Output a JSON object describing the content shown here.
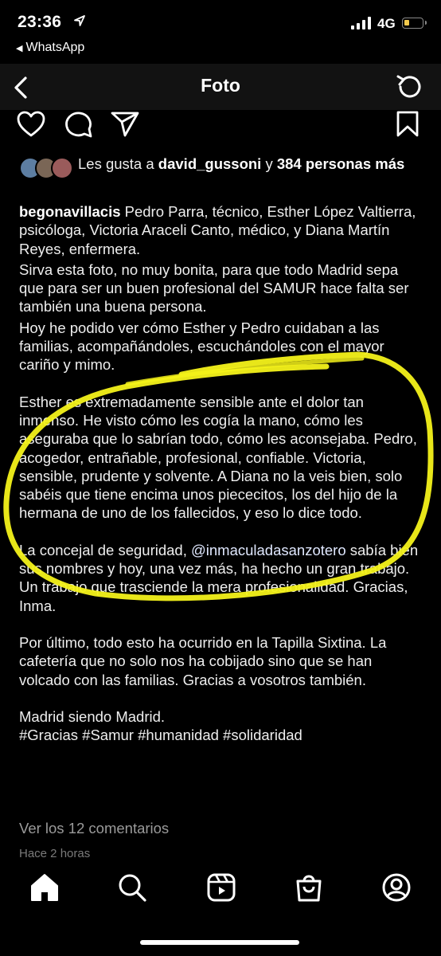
{
  "status_bar": {
    "time": "23:36",
    "back_app": "WhatsApp",
    "network": "4G"
  },
  "header": {
    "title": "Foto"
  },
  "post": {
    "likes": {
      "prefix": "Les gusta a ",
      "user": "david_gussoni",
      "middle": " y ",
      "others": "384 personas más"
    },
    "caption": {
      "username": "begonavillacis",
      "p1": " Pedro Parra, técnico, Esther López Valtierra, psicóloga, Victoria Araceli Canto, médico, y Diana Martín Reyes, enfermera.",
      "p2": "Sirva esta foto, no muy bonita, para que todo Madrid sepa que para ser un buen profesional del SAMUR hace falta ser también una buena persona.",
      "p3": "Hoy he podido ver cómo Esther y Pedro cuidaban a las familias, acompañándoles, escuchándoles con el mayor cariño y mimo.",
      "p4": "Esther es extremadamente sensible ante el dolor tan inmenso. He visto cómo les cogía la mano, cómo les aseguraba que lo sabrían todo, cómo les aconsejaba. Pedro, acogedor, entrañable, profesional, confiable. Victoria, sensible, prudente y solvente. A Diana no la veis bien, solo sabéis que tiene encima unos piececitos, los del hijo de la hermana de uno de los fallecidos, y eso lo dice todo.",
      "p5_before": "La concejal de seguridad, ",
      "p5_mention": "@inmaculadasanzotero",
      "p5_after": " sabía bien sus nombres y hoy, una vez más, ha hecho un gran trabajo. Un trabajo que trasciende la mera profesionalidad. Gracias, Inma.",
      "p6": "Por último, todo esto ha ocurrido en la Tapilla Sixtina. La cafetería que no solo nos ha cobijado sino que se han volcado con las familias. Gracias a vosotros también.",
      "p7": "Madrid siendo Madrid.",
      "hashtags": "#Gracias #Samur #humanidad #solidaridad"
    },
    "view_comments": "Ver los 12 comentarios",
    "time_ago": "Hace 2 horas"
  },
  "icons": {
    "back": "chevron-left-icon",
    "refresh": "refresh-icon",
    "like": "heart-icon",
    "comment": "comment-icon",
    "share": "send-icon",
    "save": "bookmark-icon",
    "tabs": [
      "home-icon",
      "search-icon",
      "reels-icon",
      "shop-icon",
      "profile-icon"
    ]
  },
  "colors": {
    "background": "#000000",
    "highlight": "#f4f21a"
  }
}
